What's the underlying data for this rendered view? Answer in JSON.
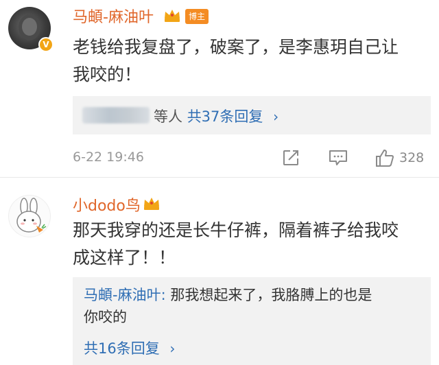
{
  "comments": [
    {
      "username": "马頔-麻油叶",
      "tag": "博主",
      "verified_badge": "V",
      "text_line1": "老钱给我复盘了，破案了，是李惠玥自己让",
      "text_line2": "我咬的！",
      "reply_others": "等人",
      "reply_count_label": "共37条回复",
      "chevron": "›",
      "timestamp": "6-22 19:46",
      "like_count": "328"
    },
    {
      "username": "小dodo鸟",
      "text_line1": "那天我穿的还是长牛仔裤，隔着裤子给我咬",
      "text_line2": "成这样了！！",
      "quoted_reply": {
        "name": "马頔-麻油叶:",
        "line1": " 那我想起来了，我胳膊上的也是",
        "line2": "你咬的"
      },
      "reply_count_label": "共16条回复",
      "chevron": "›"
    }
  ],
  "colors": {
    "username": "#e0662a",
    "link": "#2f6eb4",
    "tag_bg": "#f48c23",
    "crown": "#f2a516"
  },
  "icons": [
    "crown-icon",
    "verified-badge-icon",
    "share-icon",
    "comment-icon",
    "like-icon"
  ]
}
